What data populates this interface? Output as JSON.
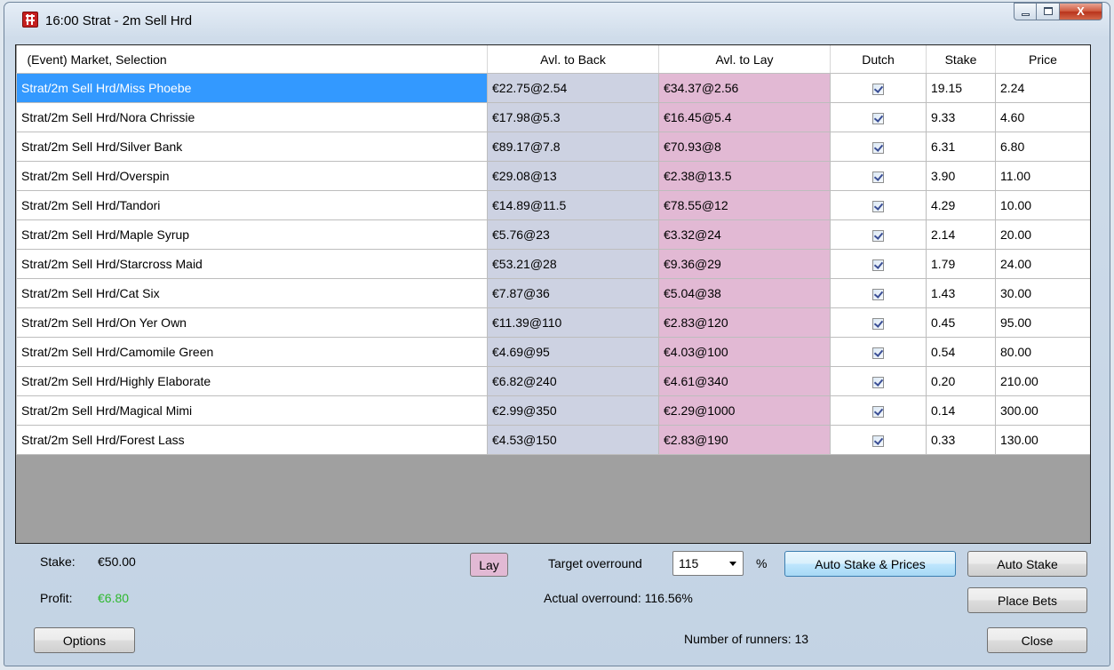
{
  "window": {
    "title": "16:00 Strat  - 2m Sell Hrd",
    "close_glyph": "X"
  },
  "grid": {
    "headers": {
      "selection": "(Event) Market, Selection",
      "back": "Avl. to Back",
      "lay": "Avl. to Lay",
      "dutch": "Dutch",
      "stake": "Stake",
      "price": "Price"
    },
    "rows": [
      {
        "selection": "Strat/2m Sell Hrd/Miss Phoebe",
        "back": "€22.75@2.54",
        "lay": "€34.37@2.56",
        "dutch": true,
        "stake": "19.15",
        "price": "2.24"
      },
      {
        "selection": "Strat/2m Sell Hrd/Nora Chrissie",
        "back": "€17.98@5.3",
        "lay": "€16.45@5.4",
        "dutch": true,
        "stake": "9.33",
        "price": "4.60"
      },
      {
        "selection": "Strat/2m Sell Hrd/Silver Bank",
        "back": "€89.17@7.8",
        "lay": "€70.93@8",
        "dutch": true,
        "stake": "6.31",
        "price": "6.80"
      },
      {
        "selection": "Strat/2m Sell Hrd/Overspin",
        "back": "€29.08@13",
        "lay": "€2.38@13.5",
        "dutch": true,
        "stake": "3.90",
        "price": "11.00"
      },
      {
        "selection": "Strat/2m Sell Hrd/Tandori",
        "back": "€14.89@11.5",
        "lay": "€78.55@12",
        "dutch": true,
        "stake": "4.29",
        "price": "10.00"
      },
      {
        "selection": "Strat/2m Sell Hrd/Maple Syrup",
        "back": "€5.76@23",
        "lay": "€3.32@24",
        "dutch": true,
        "stake": "2.14",
        "price": "20.00"
      },
      {
        "selection": "Strat/2m Sell Hrd/Starcross Maid",
        "back": "€53.21@28",
        "lay": "€9.36@29",
        "dutch": true,
        "stake": "1.79",
        "price": "24.00"
      },
      {
        "selection": "Strat/2m Sell Hrd/Cat Six",
        "back": "€7.87@36",
        "lay": "€5.04@38",
        "dutch": true,
        "stake": "1.43",
        "price": "30.00"
      },
      {
        "selection": "Strat/2m Sell Hrd/On Yer Own",
        "back": "€11.39@110",
        "lay": "€2.83@120",
        "dutch": true,
        "stake": "0.45",
        "price": "95.00"
      },
      {
        "selection": "Strat/2m Sell Hrd/Camomile Green",
        "back": "€4.69@95",
        "lay": "€4.03@100",
        "dutch": true,
        "stake": "0.54",
        "price": "80.00"
      },
      {
        "selection": "Strat/2m Sell Hrd/Highly Elaborate",
        "back": "€6.82@240",
        "lay": "€4.61@340",
        "dutch": true,
        "stake": "0.20",
        "price": "210.00"
      },
      {
        "selection": "Strat/2m Sell Hrd/Magical Mimi",
        "back": "€2.99@350",
        "lay": "€2.29@1000",
        "dutch": true,
        "stake": "0.14",
        "price": "300.00"
      },
      {
        "selection": "Strat/2m Sell Hrd/Forest Lass",
        "back": "€4.53@150",
        "lay": "€2.83@190",
        "dutch": true,
        "stake": "0.33",
        "price": "130.00"
      }
    ]
  },
  "footer": {
    "stake_label": "Stake:",
    "stake_value": "€50.00",
    "profit_label": "Profit:",
    "profit_value": "€6.80",
    "lay_button": "Lay",
    "target_overround_label": "Target overround",
    "target_overround_value": "115",
    "percent_sign": "%",
    "auto_stake_prices_button": "Auto Stake & Prices",
    "auto_stake_button": "Auto Stake",
    "actual_overround": "Actual overround: 116.56%",
    "place_bets_button": "Place Bets",
    "options_button": "Options",
    "runners": "Number of runners: 13",
    "close_button": "Close"
  },
  "colors": {
    "back_column": "#cdd2e2",
    "lay_column": "#e2b9d4",
    "selected_row": "#3399ff",
    "profit_text": "#2db82d"
  },
  "icons": {
    "app": "racing-app-icon",
    "minimize": "minimize-icon",
    "maximize": "maximize-icon",
    "close": "close-icon",
    "dropdown": "chevron-down-icon",
    "dutch": "checkbox-checked-icon"
  }
}
